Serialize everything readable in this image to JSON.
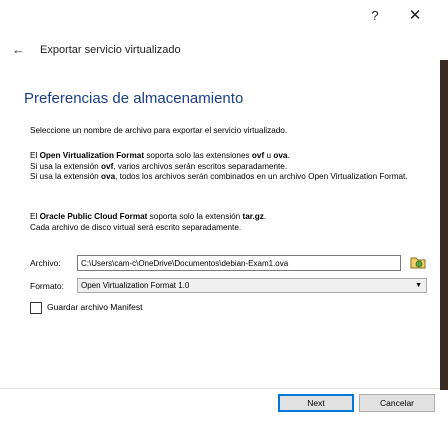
{
  "window": {
    "help_label": "?",
    "close_label": "✕"
  },
  "nav": {
    "title": "Exportar servicio virtualizado",
    "back_icon": "←"
  },
  "page": {
    "title": "Preferencias de almacenamiento"
  },
  "intro": "Seleccione un nombre de archivo para exportar el servicio virtualizado.",
  "ovf": {
    "line1_prefix": "El ",
    "line1_bold": "Open Virtualization Format",
    "line1_mid": " soporta solo las extensiones ",
    "line1_ext1": "ovf",
    "line1_sep": " u ",
    "line1_ext2": "ova",
    "line1_end": ".",
    "line2_prefix": "Si usa la extensión ",
    "line2_bold": "ovf",
    "line2_rest": ", varios archivos serán escritos separadamente.",
    "line3_prefix": "Si usa la extensión ",
    "line3_bold": "ova",
    "line3_rest": ", todos los archivos serán combinados en un archivo Open Virtualization Format."
  },
  "opc": {
    "line1_prefix": "El ",
    "line1_bold": "Oracle Public Cloud Format",
    "line1_mid": " soporta solo la extensión ",
    "line1_ext": "tar.gz",
    "line1_end": ".",
    "line2": "Cada archivo de disco virtual será escrito separadamente."
  },
  "form": {
    "file_label": "Archivo:",
    "file_value": "C:\\Users\\cam-c\\OneDrive\\Documentos\\debian-Exam1.ova",
    "format_label": "Formato:",
    "format_value": "Open Virtualization Format 1.0",
    "manifest_label": "Guardar archivo Manifest"
  },
  "buttons": {
    "next": "Next",
    "cancel": "Cancelar"
  },
  "colors": {
    "title": "#1a3e8c",
    "focus": "#0078d7"
  }
}
